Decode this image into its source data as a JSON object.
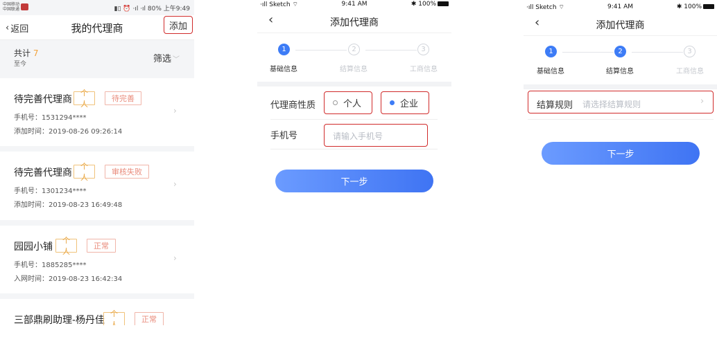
{
  "screen1": {
    "status": {
      "carrier_top": "中国移动",
      "carrier_bottom": "中国联通",
      "right": "80%  上午9:49"
    },
    "nav": {
      "back_label": "返回",
      "title": "我的代理商",
      "add_label": "添加"
    },
    "summary": {
      "total_label": "共计",
      "total_count": "7",
      "since_label": "至今",
      "filter_label": "筛选"
    },
    "cards": [
      {
        "name": "待完善代理商",
        "tags": [
          "个人",
          "待完善"
        ],
        "phone": "手机号：1531294****",
        "time": "添加时间：2019-08-26 09:26:14"
      },
      {
        "name": "待完善代理商",
        "tags": [
          "个人",
          "审核失败"
        ],
        "phone": "手机号：1301234****",
        "time": "添加时间：2019-08-23 16:49:48"
      },
      {
        "name": "园园小铺",
        "tags": [
          "个人",
          "正常"
        ],
        "phone": "手机号：1885285****",
        "time": "入网时间：2019-08-23 16:42:34"
      },
      {
        "name": "三部鼎刷助理-杨丹佳",
        "tags": [
          "个人",
          "正常"
        ]
      }
    ]
  },
  "screen2": {
    "status": {
      "left": "Sketch",
      "center": "9:41 AM",
      "right": "100%"
    },
    "nav": {
      "title": "添加代理商"
    },
    "steps": [
      {
        "num": "1",
        "label": "基础信息",
        "state": "active"
      },
      {
        "num": "2",
        "label": "结算信息",
        "state": "inactive"
      },
      {
        "num": "3",
        "label": "工商信息",
        "state": "inactive"
      }
    ],
    "form": {
      "type_label": "代理商性质",
      "option_personal": "个人",
      "option_company": "企业",
      "selected": "企业",
      "phone_label": "手机号",
      "phone_placeholder": "请输入手机号"
    },
    "next_label": "下一步"
  },
  "screen3": {
    "status": {
      "left": "Sketch",
      "center": "9:41 AM",
      "right": "100%"
    },
    "nav": {
      "title": "添加代理商"
    },
    "steps": [
      {
        "num": "1",
        "label": "基础信息",
        "state": "active"
      },
      {
        "num": "2",
        "label": "结算信息",
        "state": "active"
      },
      {
        "num": "3",
        "label": "工商信息",
        "state": "inactive"
      }
    ],
    "form": {
      "rule_label": "结算规则",
      "rule_placeholder": "请选择结算规则"
    },
    "next_label": "下一步"
  },
  "colors": {
    "accent": "#3d7cf6",
    "highlight_border": "#d02a2a",
    "tag_orange": "#e8a23a",
    "tag_pink": "#e98b7b"
  }
}
